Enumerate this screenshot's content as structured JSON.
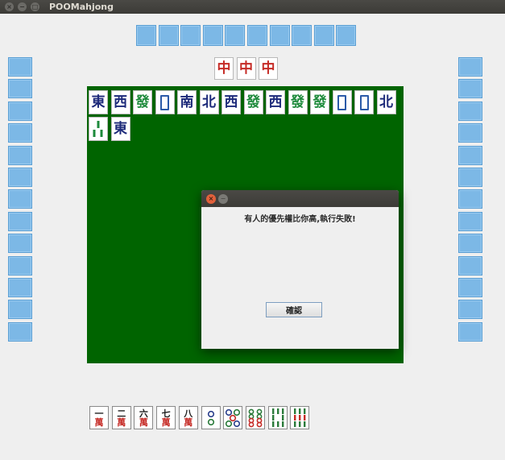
{
  "window": {
    "title": "POOMahjong",
    "buttons": [
      "×",
      "−",
      "□"
    ]
  },
  "top_player": {
    "hidden_tiles": 10
  },
  "left_player": {
    "hidden_tiles": 13
  },
  "right_player": {
    "hidden_tiles": 13
  },
  "top_melds": [
    "中",
    "中",
    "中"
  ],
  "discards": [
    {
      "char": "東",
      "color": "blue"
    },
    {
      "char": "西",
      "color": "blue"
    },
    {
      "char": "發",
      "color": "green"
    },
    {
      "char": "",
      "color": "white"
    },
    {
      "char": "南",
      "color": "blue"
    },
    {
      "char": "北",
      "color": "blue"
    },
    {
      "char": "西",
      "color": "blue"
    },
    {
      "char": "發",
      "color": "green"
    },
    {
      "char": "西",
      "color": "blue"
    },
    {
      "char": "發",
      "color": "green"
    },
    {
      "char": "發",
      "color": "green"
    },
    {
      "char": "",
      "color": "white"
    },
    {
      "char": "",
      "color": "white"
    },
    {
      "char": "北",
      "color": "blue"
    },
    {
      "char": "",
      "color": "bamboo3"
    },
    {
      "char": "東",
      "color": "blue"
    }
  ],
  "hand": [
    {
      "type": "wan",
      "num": "一",
      "suit": "萬"
    },
    {
      "type": "wan",
      "num": "二",
      "suit": "萬"
    },
    {
      "type": "wan",
      "num": "六",
      "suit": "萬"
    },
    {
      "type": "wan",
      "num": "七",
      "suit": "萬"
    },
    {
      "type": "wan",
      "num": "八",
      "suit": "萬"
    },
    {
      "type": "circle",
      "count": 2
    },
    {
      "type": "circle",
      "count": 5
    },
    {
      "type": "circle",
      "count": 8
    },
    {
      "type": "bamboo",
      "count": 8
    },
    {
      "type": "bamboo",
      "count": 9
    }
  ],
  "dialog": {
    "message": "有人的優先權比你高,執行失敗!",
    "ok_label": "確認",
    "close_glyph": "×",
    "min_glyph": "−"
  },
  "colors": {
    "board": "#006400",
    "tile_back": "#7cb8e6",
    "red": "#c52a25",
    "blue": "#1d2a7a",
    "green": "#1d8a3b"
  }
}
